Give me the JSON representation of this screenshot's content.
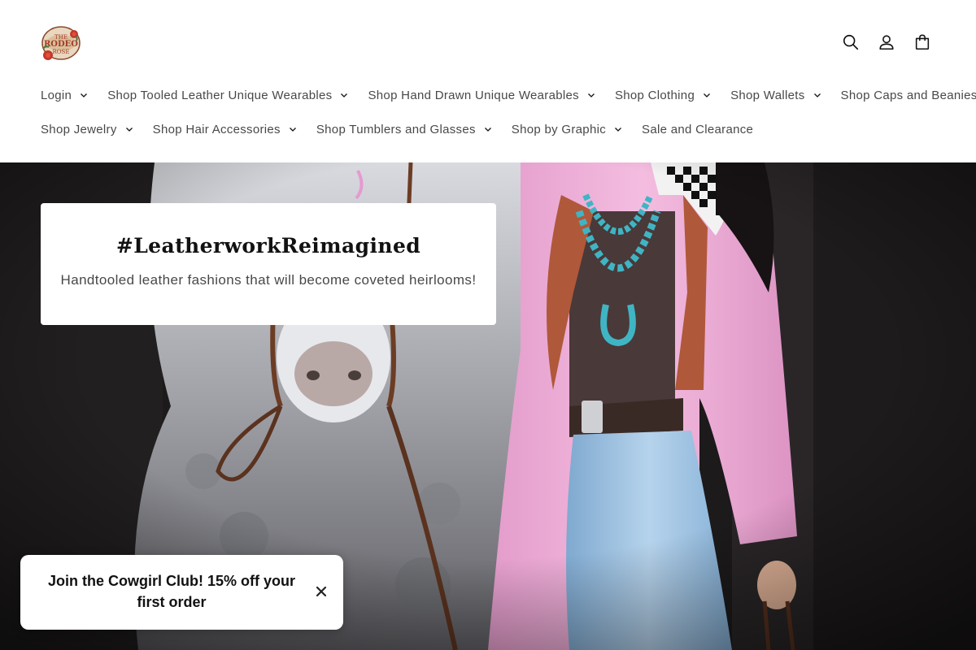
{
  "header": {
    "logo_alt": "The Rodeo Rose",
    "icons": [
      "search-icon",
      "account-icon",
      "cart-icon"
    ]
  },
  "nav": {
    "row1": [
      {
        "label": "Login",
        "has_dropdown": true
      },
      {
        "label": "Shop Tooled Leather Unique Wearables",
        "has_dropdown": true
      },
      {
        "label": "Shop Hand Drawn Unique Wearables",
        "has_dropdown": true
      },
      {
        "label": "Shop Clothing",
        "has_dropdown": true
      },
      {
        "label": "Shop Wallets",
        "has_dropdown": true
      },
      {
        "label": "Shop Caps and Beanies",
        "has_dropdown": true
      }
    ],
    "row2": [
      {
        "label": "Shop Jewelry",
        "has_dropdown": true
      },
      {
        "label": "Shop Hair Accessories",
        "has_dropdown": true
      },
      {
        "label": "Shop Tumblers and Glasses",
        "has_dropdown": true
      },
      {
        "label": "Shop by Graphic",
        "has_dropdown": true
      },
      {
        "label": "Sale and Clearance",
        "has_dropdown": false
      }
    ]
  },
  "hero": {
    "title": "#LeatherworkReimagined",
    "subtitle": "Handtooled leather fashions that will become coveted heirlooms!"
  },
  "popup": {
    "text": "Join the Cowgirl Club! 15% off your first order"
  },
  "colors": {
    "text": "#121212",
    "blazer": "#f0b3d8",
    "turquoise": "#3fb5c4",
    "denim": "#9cc4e4"
  }
}
